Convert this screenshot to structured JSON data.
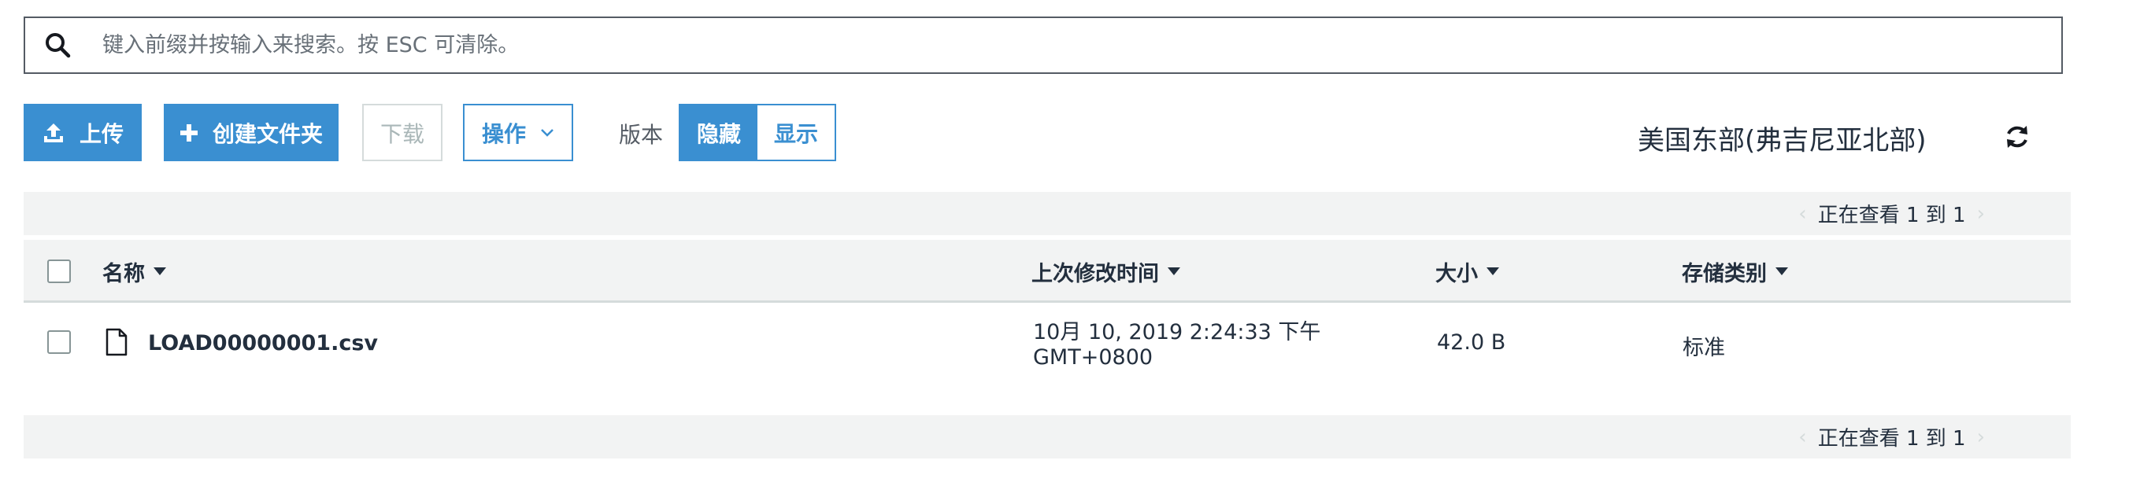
{
  "search": {
    "placeholder": "键入前缀并按输入来搜索。按 ESC 可清除。",
    "icon": "search-icon"
  },
  "toolbar": {
    "upload_label": "上传",
    "create_folder_label": "创建文件夹",
    "download_label": "下载",
    "actions_label": "操作",
    "version_label": "版本",
    "version_hide": "隐藏",
    "version_show": "显示",
    "version_selected": "隐藏",
    "region": "美国东部(弗吉尼亚北部)"
  },
  "pager": {
    "text": "正在查看 1 到 1"
  },
  "table": {
    "columns": [
      "名称",
      "上次修改时间",
      "大小",
      "存储类别"
    ],
    "rows": [
      {
        "name": "LOAD00000001.csv",
        "modified_line1": "10月 10, 2019 2:24:33 下午",
        "modified_line2": "GMT+0800",
        "size": "42.0 B",
        "storage_class": "标准"
      }
    ]
  },
  "colors": {
    "primary": "#3a8fd1",
    "border_dark": "#545b64",
    "bar_bg": "#f2f3f3",
    "disabled": "#aab7b8"
  }
}
